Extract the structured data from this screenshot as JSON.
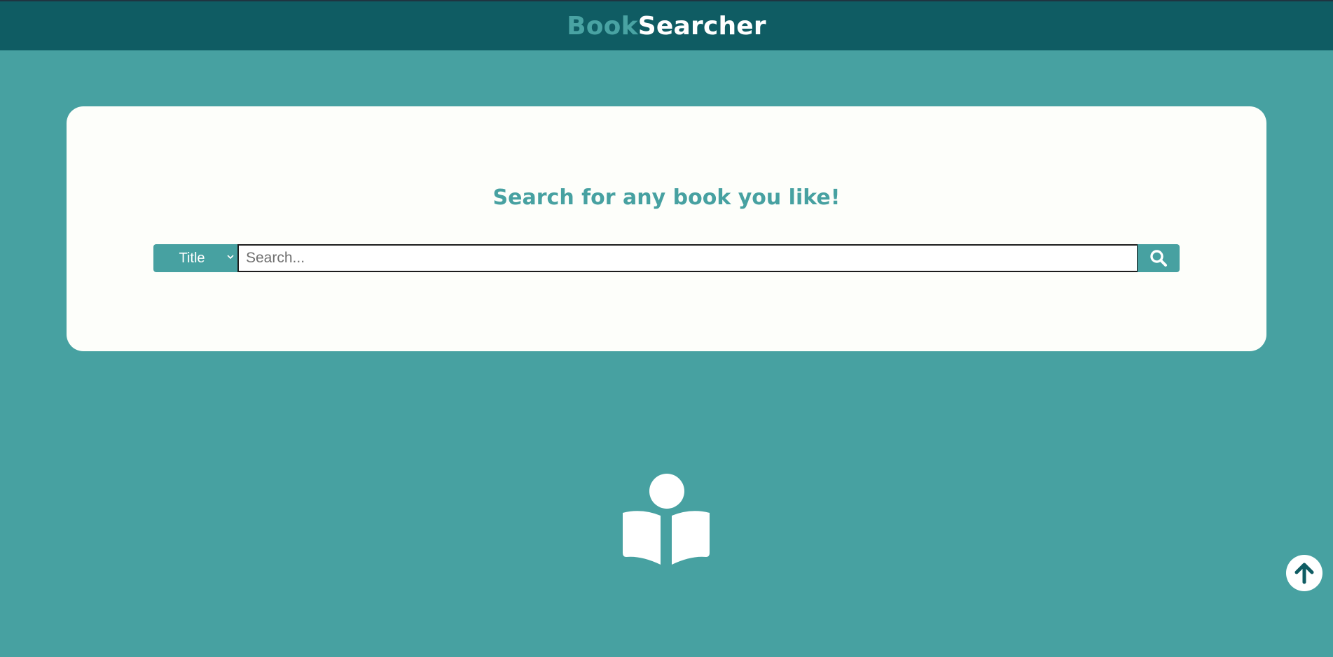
{
  "header": {
    "brand_part1": "Book",
    "brand_part2": "Searcher"
  },
  "search_card": {
    "heading": "Search for any book you like!",
    "filter_select": {
      "selected": "Title"
    },
    "search_input": {
      "placeholder": "Search...",
      "value": ""
    }
  },
  "icons": {
    "search": "search-icon",
    "hero": "reader-book-icon",
    "scroll_top": "arrow-up-icon",
    "chevron": "chevron-down-icon"
  },
  "colors": {
    "background": "#47a1a1",
    "header": "#0f5c63",
    "card": "#fdfefa",
    "accent": "#47a1a1",
    "brand_dark": "#0f5c63"
  }
}
